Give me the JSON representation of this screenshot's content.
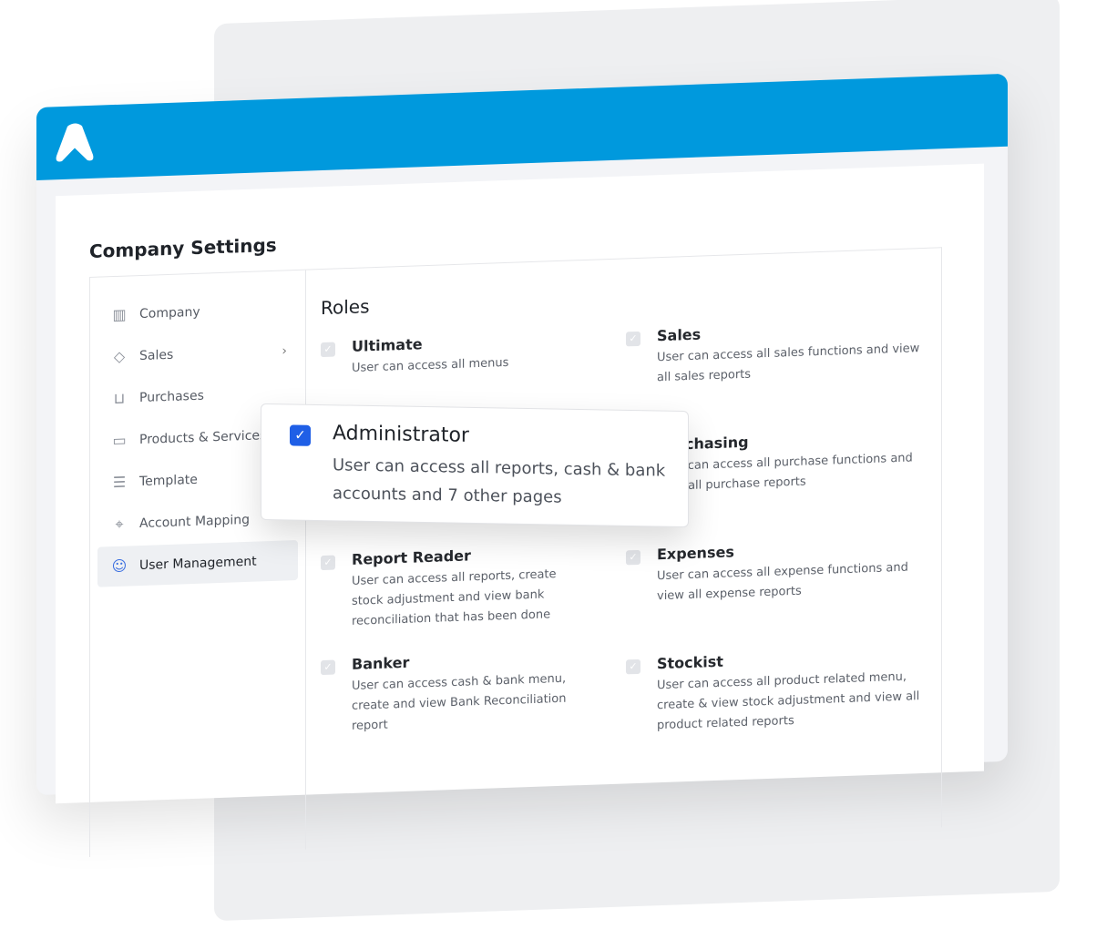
{
  "colors": {
    "brand": "#0099dd",
    "checkbox_active": "#1f5fe6"
  },
  "header": {
    "logo": "A"
  },
  "page_title": "Company Settings",
  "sidebar": {
    "items": [
      {
        "label": "Company",
        "icon": "building-icon"
      },
      {
        "label": "Sales",
        "icon": "tag-icon",
        "has_submenu": true
      },
      {
        "label": "Purchases",
        "icon": "cart-icon"
      },
      {
        "label": "Products & Services",
        "icon": "box-icon"
      },
      {
        "label": "Template",
        "icon": "document-icon"
      },
      {
        "label": "Account Mapping",
        "icon": "location-pin-icon"
      },
      {
        "label": "User Management",
        "icon": "user-icon",
        "active": true
      }
    ]
  },
  "roles": {
    "title": "Roles",
    "items": [
      {
        "name": "Ultimate",
        "desc": "User can access all menus",
        "checked": true
      },
      {
        "name": "Sales",
        "desc": "User can access all sales functions and view all sales reports",
        "checked": true
      },
      {
        "name": "Purchasing",
        "desc": "User can access all purchase functions and view all purchase reports",
        "checked": true
      },
      {
        "name": "Report Reader",
        "desc": "User can access all reports, create stock adjustment and view bank reconciliation that has been done",
        "checked": true
      },
      {
        "name": "Expenses",
        "desc": "User can access all expense functions and view all expense reports",
        "checked": true
      },
      {
        "name": "Banker",
        "desc": "User can access cash & bank menu, create and view Bank Reconciliation report",
        "checked": true
      },
      {
        "name": "Stockist",
        "desc": "User can access all product related menu, create & view stock adjustment and view all product related reports",
        "checked": true
      }
    ]
  },
  "popup": {
    "name": "Administrator",
    "desc": "User can access all reports, cash & bank accounts and 7 other pages",
    "checked": true
  }
}
